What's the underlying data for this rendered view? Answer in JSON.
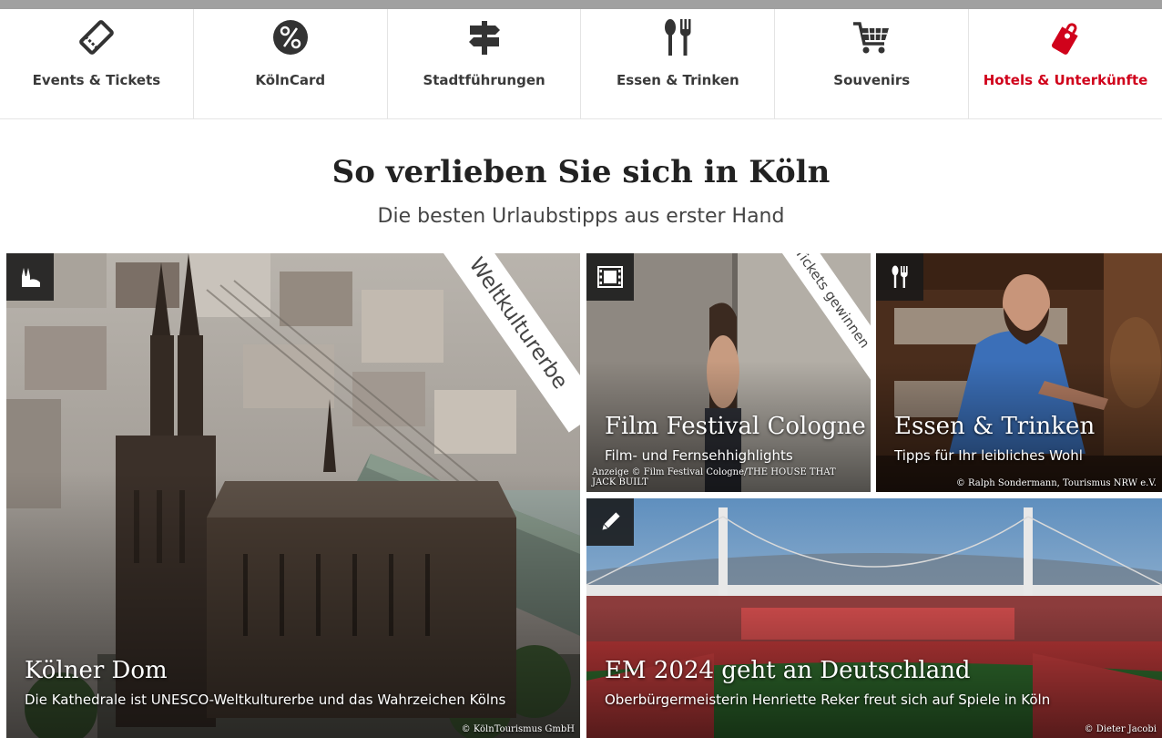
{
  "nav": {
    "items": [
      {
        "label": "Events & Tickets",
        "icon": "ticket-icon"
      },
      {
        "label": "KölnCard",
        "icon": "percent-icon"
      },
      {
        "label": "Stadtführungen",
        "icon": "signpost-icon"
      },
      {
        "label": "Essen & Trinken",
        "icon": "cutlery-icon"
      },
      {
        "label": "Souvenirs",
        "icon": "shopping-cart-icon"
      },
      {
        "label": "Hotels & Unterkünfte",
        "icon": "hotel-tag-icon"
      }
    ],
    "active_color": "#d0021b"
  },
  "heading": {
    "title": "So verlieben Sie sich in Köln",
    "subtitle": "Die besten Urlaubstipps aus erster Hand"
  },
  "tiles": {
    "dom": {
      "title": "Kölner Dom",
      "subtitle": "Die Kathedrale ist UNESCO-Weltkulturerbe und das Wahrzeichen Kölns",
      "ribbon": "Weltkulturerbe",
      "credit": "© KölnTourismus GmbH",
      "icon": "cathedral-icon"
    },
    "film": {
      "title": "Film Festival Cologne",
      "subtitle": "Film- und Fernsehhighlights",
      "ribbon": "Tickets gewinnen",
      "credit_line1": "Anzeige © Film Festival Cologne/THE HOUSE THAT",
      "credit_line2": "JACK BUILT",
      "icon": "film-icon"
    },
    "essen": {
      "title": "Essen & Trinken",
      "subtitle": "Tipps für Ihr leibliches Wohl",
      "credit": "© Ralph Sondermann, Tourismus NRW e.V.",
      "icon": "cutlery-icon"
    },
    "em": {
      "title": "EM 2024 geht an Deutschland",
      "subtitle": "Oberbürgermeisterin Henriette Reker freut sich auf Spiele in Köln",
      "credit": "© Dieter Jacobi",
      "icon": "pencil-icon"
    }
  }
}
